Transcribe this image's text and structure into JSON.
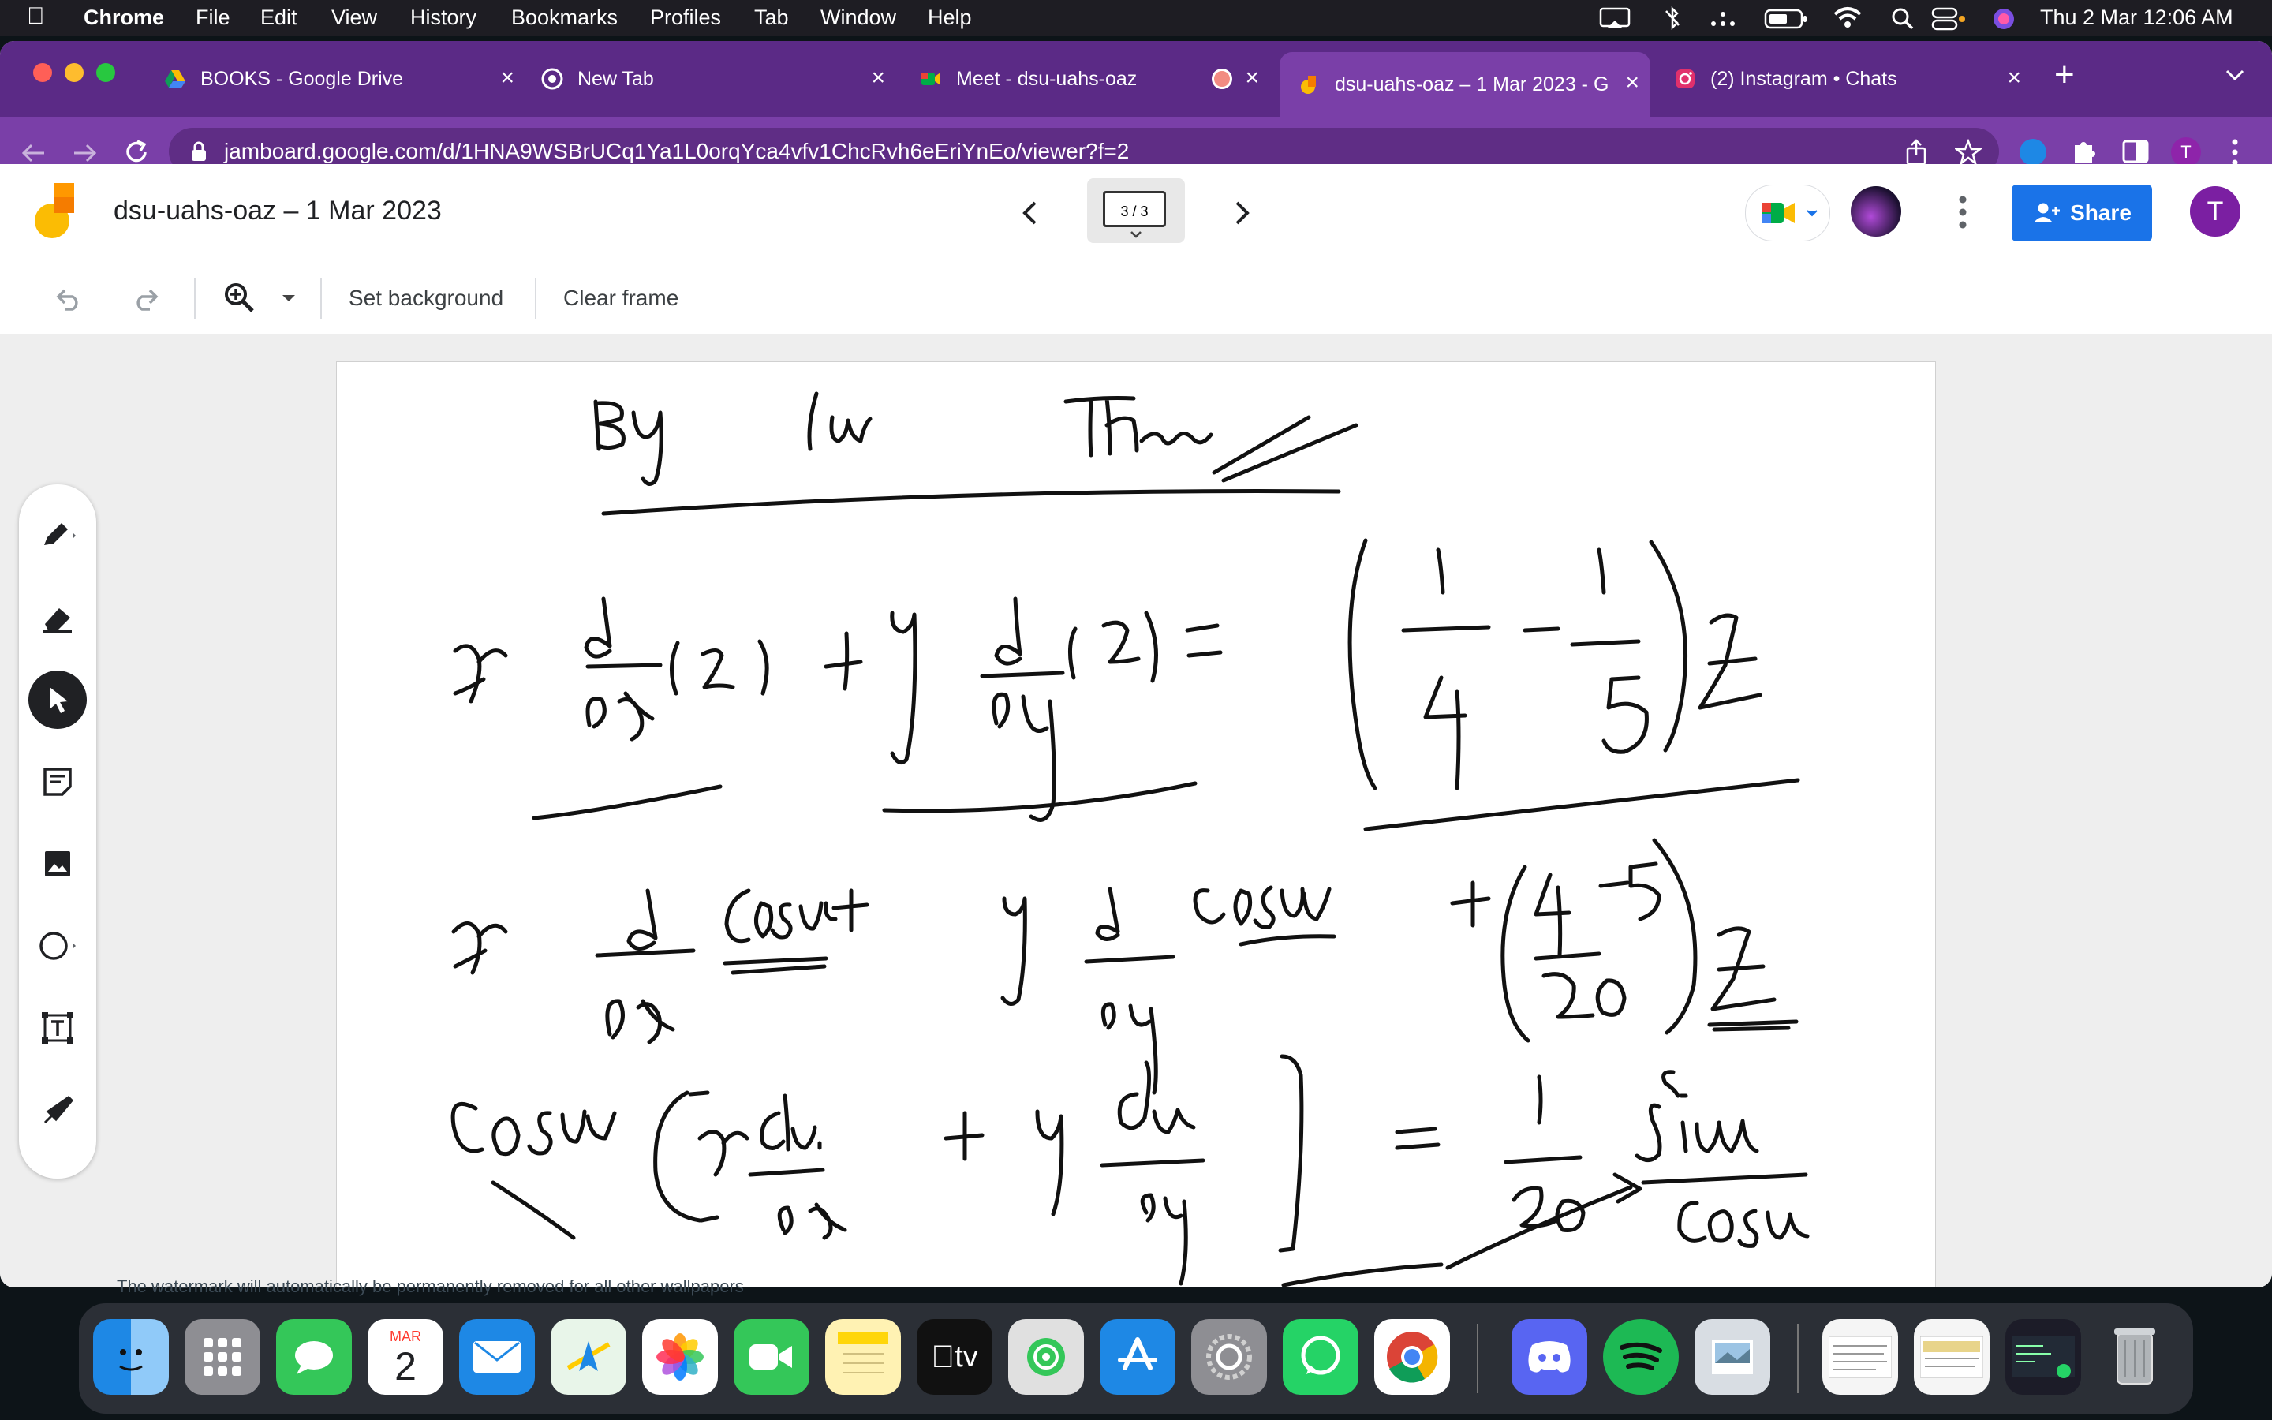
{
  "menubar": {
    "app": "Chrome",
    "items": [
      "File",
      "Edit",
      "View",
      "History",
      "Bookmarks",
      "Profiles",
      "Tab",
      "Window",
      "Help"
    ],
    "clock": "Thu 2 Mar  12:06 AM"
  },
  "tabs": [
    {
      "title": "BOOKS - Google Drive",
      "icon": "google-drive-icon"
    },
    {
      "title": "New Tab",
      "icon": "chrome-icon"
    },
    {
      "title": "Meet - dsu-uahs-oaz",
      "icon": "google-meet-icon"
    },
    {
      "title": "dsu-uahs-oaz – 1 Mar 2023 - G",
      "icon": "jamboard-icon",
      "active": true
    },
    {
      "title": "(2) Instagram • Chats",
      "icon": "instagram-icon"
    }
  ],
  "address": {
    "url": "jamboard.google.com/d/1HNA9WSBrUCq1Ya1L0orqYca4vfv1ChcRvh6eEriYnEo/viewer?f=2"
  },
  "jam": {
    "title": "dsu-uahs-oaz – 1 Mar 2023",
    "frame_indicator": "3 / 3",
    "share_label": "Share",
    "avatar_letter": "T",
    "set_background": "Set background",
    "clear_frame": "Clear frame"
  },
  "wallpaper_note": "The watermark will automatically be permanently removed for all other wallpapers",
  "dock": {
    "calendar_month": "MAR",
    "calendar_day": "2",
    "tv_label": "tv"
  },
  "colors": {
    "tabstrip": "#5b2a86",
    "toolbar": "#7a3fa8",
    "share_button": "#1a73e8",
    "avatar": "#7b1fa2"
  }
}
